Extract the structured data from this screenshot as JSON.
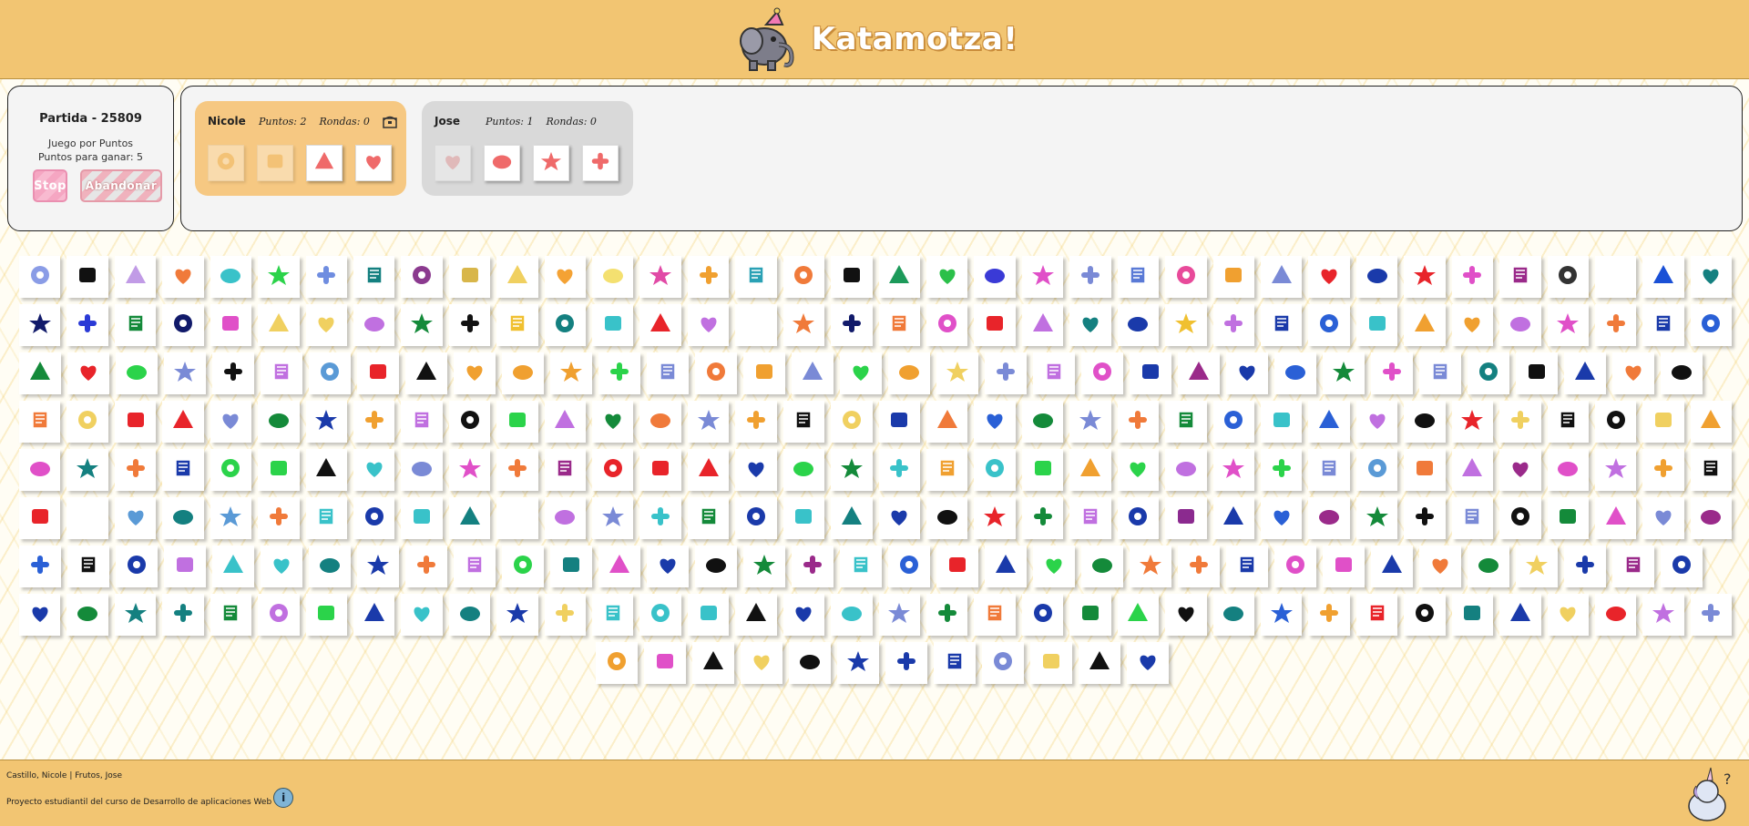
{
  "app": {
    "title": "Katamotza!"
  },
  "game": {
    "id_label": "Partida - 25809",
    "mode": "Juego por Puntos",
    "goal": "Puntos para ganar: 5",
    "stop_label": "Stop",
    "abandon_label": "Abandonar"
  },
  "players": [
    {
      "name": "Nicole",
      "points": "Puntos: 2",
      "rounds": "Rondas: 0",
      "cards": [
        {
          "icon": "key-icon",
          "color": "#f0b860",
          "used": true
        },
        {
          "icon": "card-icon",
          "color": "#f0b860",
          "used": true
        },
        {
          "icon": "feather-icon",
          "color": "#ef6a6a",
          "used": false
        },
        {
          "icon": "refresh-icon",
          "color": "#ef6a6a",
          "used": false
        }
      ]
    },
    {
      "name": "Jose",
      "points": "Puntos: 1",
      "rounds": "Rondas: 0",
      "cards": [
        {
          "icon": "gamepad-icon",
          "color": "#ef8080",
          "used": true
        },
        {
          "icon": "pill-icon",
          "color": "#ef6a6a",
          "used": false
        },
        {
          "icon": "ring-icon",
          "color": "#ef6a6a",
          "used": false
        },
        {
          "icon": "ghost-icon",
          "color": "#ef6a6a",
          "used": false
        }
      ]
    }
  ],
  "board": {
    "rows": [
      [
        "#8a9ce6",
        "#111",
        "#c19be6",
        "#f07a3a",
        "#39c2c9",
        "#2bd34a",
        "#6f8de0",
        "#148080",
        "#8b3a8f",
        "#d8b64a",
        "#f0d060",
        "#f4a234",
        "#f4e070",
        "#e14aa6",
        "#f0a030",
        "#2aa1b5",
        "#f07a3a",
        "#111",
        "#1c9a5a",
        "#2bc04a",
        "#3a3ad6",
        "#e050c8",
        "#7a8ad6",
        "#5a7ad6",
        "#e84a9a",
        "#f0a030",
        "#7a8ad6",
        "#e8242a",
        "#1a3aaa",
        "#e8242a",
        "#e050c8",
        "#9a2a8a",
        "#333",
        "#eee",
        "#1a50d6",
        "#148080"
      ],
      [
        "#111a6a",
        "#2a3ad6",
        "#148a3a",
        "#111a6a",
        "#e050c8",
        "#f0d060",
        "#f0d060",
        "#c070e0",
        "#148a3a",
        "#111",
        "#f0c030",
        "#148080",
        "#39c2c9",
        "#e8242a",
        "#c070e0",
        "#eee",
        "#f07a3a",
        "#111a6a",
        "#f07a3a",
        "#e050c8",
        "#e8242a",
        "#c070e0",
        "#148080",
        "#1a3aaa",
        "#f0c030",
        "#c070e0",
        "#1a3aaa",
        "#2a60d6",
        "#39c2c9",
        "#f0a030",
        "#f0a030",
        "#c070e0",
        "#e050c8",
        "#f07a3a",
        "#1a3aaa",
        "#2a60d6"
      ],
      [
        "#148a3a",
        "#e8242a",
        "#2bd34a",
        "#7a8ad6",
        "#111",
        "#c070e0",
        "#5a9ad6",
        "#e8242a",
        "#111",
        "#f0a030",
        "#f0a030",
        "#f0a030",
        "#2bd34a",
        "#7a8ad6",
        "#f07a3a",
        "#f0a030",
        "#7a8ad6",
        "#2bd34a",
        "#f0a030",
        "#f0d060",
        "#7a8ad6",
        "#c070e0",
        "#e050c8",
        "#1a3aaa",
        "#9a2a8a",
        "#1a3aaa",
        "#2a60d6",
        "#148a3a",
        "#e050c8",
        "#7a8ad6",
        "#148080",
        "#111",
        "#1a3aaa",
        "#f07a3a",
        "#111"
      ],
      [
        "#f07a3a",
        "#f0d060",
        "#e8242a",
        "#e8242a",
        "#7a8ad6",
        "#148a3a",
        "#1a3aaa",
        "#f0a030",
        "#c070e0",
        "#111",
        "#2bd34a",
        "#c070e0",
        "#148a3a",
        "#f07a3a",
        "#7a8ad6",
        "#f0a030",
        "#111",
        "#f0d060",
        "#1a3aaa",
        "#f07a3a",
        "#2a60d6",
        "#148a3a",
        "#7a8ad6",
        "#f07a3a",
        "#148a3a",
        "#2a60d6",
        "#39c2c9",
        "#2a60d6",
        "#c070e0",
        "#111",
        "#e8242a",
        "#f0d060",
        "#111",
        "#111",
        "#f0d060",
        "#f0a030"
      ],
      [
        "#e050c8",
        "#148080",
        "#f07a3a",
        "#1a3aaa",
        "#2bd34a",
        "#2bd34a",
        "#111",
        "#39c2c9",
        "#7a8ad6",
        "#e050c8",
        "#f07a3a",
        "#9a2a8a",
        "#e8242a",
        "#e8242a",
        "#e8242a",
        "#1a3aaa",
        "#2bd34a",
        "#148a3a",
        "#39c2c9",
        "#f0a030",
        "#39c2c9",
        "#2bd34a",
        "#f0a030",
        "#2bd34a",
        "#c070e0",
        "#e050c8",
        "#2bd34a",
        "#7a8ad6",
        "#5a9ad6",
        "#f07a3a",
        "#c070e0",
        "#9a2a8a",
        "#e050c8",
        "#c070e0",
        "#f0a030",
        "#111"
      ],
      [
        "#e8242a",
        "#eee",
        "#5a9ad6",
        "#148080",
        "#5a9ad6",
        "#f07a3a",
        "#39c2c9",
        "#1a3aaa",
        "#39c2c9",
        "#148080",
        "#eee",
        "#c070e0",
        "#7a8ad6",
        "#39c2c9",
        "#148a3a",
        "#1a3aaa",
        "#39c2c9",
        "#148080",
        "#1a3aaa",
        "#111",
        "#e8242a",
        "#148a3a",
        "#c070e0",
        "#1a3aaa",
        "#8b2a8f",
        "#1a3aaa",
        "#2a60d6",
        "#9a2a8a",
        "#148a3a",
        "#111",
        "#7a8ad6",
        "#111",
        "#148a3a",
        "#e050c8",
        "#7a8ad6",
        "#9a2a8a"
      ],
      [
        "#2a60d6",
        "#111",
        "#1a3aaa",
        "#c070e0",
        "#39c2c9",
        "#39c2c9",
        "#148080",
        "#1a3aaa",
        "#f07a3a",
        "#c070e0",
        "#2bd34a",
        "#148080",
        "#e050c8",
        "#1a3aaa",
        "#111",
        "#148a3a",
        "#9a2a8a",
        "#39c2c9",
        "#2a60d6",
        "#e8242a",
        "#1a3aaa",
        "#2bd34a",
        "#148a3a",
        "#f07a3a",
        "#f07a3a",
        "#1a3aaa",
        "#e050c8",
        "#e050c8",
        "#1a3aaa",
        "#f07a3a",
        "#148a3a",
        "#f0d060",
        "#1a3aaa",
        "#9a2a8a",
        "#1a3aaa"
      ],
      [
        "#1a3aaa",
        "#148a3a",
        "#148080",
        "#148080",
        "#148a3a",
        "#c070e0",
        "#2bd34a",
        "#1a3aaa",
        "#39c2c9",
        "#148080",
        "#1a3aaa",
        "#f0d060",
        "#39c2c9",
        "#39c2c9",
        "#39c2c9",
        "#111",
        "#1a3aaa",
        "#39c2c9",
        "#7a8ad6",
        "#148a3a",
        "#f07a3a",
        "#1a3aaa",
        "#148a3a",
        "#2bd34a",
        "#111",
        "#148080",
        "#2a60d6",
        "#f0a030",
        "#e8242a",
        "#111",
        "#148080",
        "#1a3aaa",
        "#f0d060",
        "#e8242a",
        "#c070e0",
        "#7a8ad6"
      ],
      [
        "#f0a030",
        "#e050c8",
        "#111",
        "#f0d060",
        "#111",
        "#1a3aaa",
        "#1a3aaa",
        "#1a3aaa",
        "#7a8ad6",
        "#f0d060",
        "#111",
        "#1a3aaa"
      ]
    ]
  },
  "footer": {
    "credit": "Castillo, Nicole | Frutos, Jose",
    "project": "Proyecto estudiantil del curso de Desarrollo de aplicaciones Web"
  }
}
